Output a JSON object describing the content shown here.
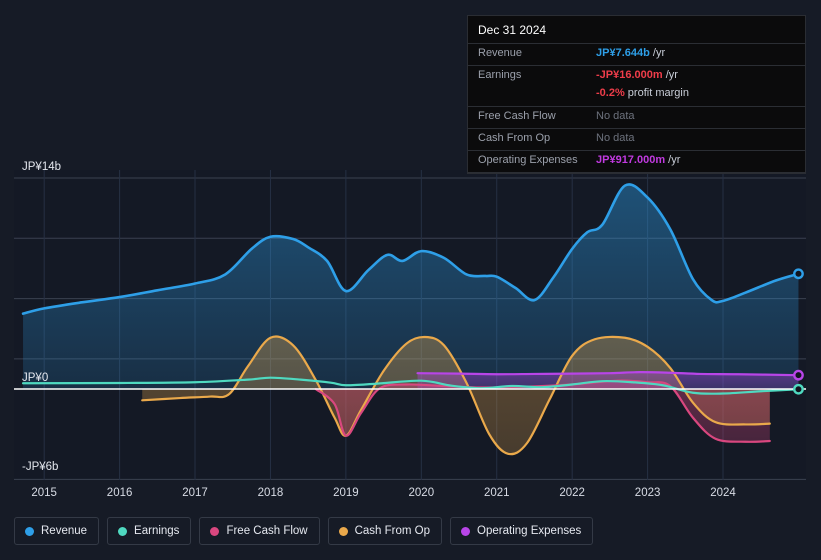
{
  "tooltip": {
    "title": "Dec 31 2024",
    "rows": [
      {
        "key": "Revenue",
        "value": "JP¥7.644b",
        "unit": "/yr",
        "color_class": "c-rev",
        "nodata": false
      },
      {
        "key": "Earnings",
        "value": "-JP¥16.000m",
        "unit": "/yr",
        "color_class": "c-earn",
        "nodata": false
      },
      {
        "key": "",
        "value": "-0.2%",
        "unit": "profit margin",
        "color_class": "c-earn",
        "nodata": false,
        "sub": true
      },
      {
        "key": "Free Cash Flow",
        "value": "No data",
        "unit": "",
        "color_class": "",
        "nodata": true
      },
      {
        "key": "Cash From Op",
        "value": "No data",
        "unit": "",
        "color_class": "",
        "nodata": true
      },
      {
        "key": "Operating Expenses",
        "value": "JP¥917.000m",
        "unit": "/yr",
        "color_class": "c-opex",
        "nodata": false
      }
    ]
  },
  "legend": {
    "items": [
      {
        "label": "Revenue",
        "color": "#2e9fe8"
      },
      {
        "label": "Earnings",
        "color": "#4fd9c0"
      },
      {
        "label": "Free Cash Flow",
        "color": "#d9477f"
      },
      {
        "label": "Cash From Op",
        "color": "#eaa94b"
      },
      {
        "label": "Operating Expenses",
        "color": "#b845e8"
      }
    ]
  },
  "axes": {
    "y_top_label": "JP¥14b",
    "y_zero_label": "JP¥0",
    "y_bottom_label": "-JP¥6b",
    "x_labels": [
      "2015",
      "2016",
      "2017",
      "2018",
      "2019",
      "2020",
      "2021",
      "2022",
      "2023",
      "2024"
    ]
  },
  "chart_data": {
    "type": "area",
    "title": "",
    "subtitle": "",
    "xlabel": "",
    "ylabel": "JP¥",
    "currency": "JPY",
    "y_unit": "billions",
    "ylim": [
      -6,
      14
    ],
    "y_ticks": [
      14,
      10,
      6,
      2,
      -6
    ],
    "y_tick_labels": [
      "JP¥14b",
      "",
      "",
      "",
      "-JP¥6b"
    ],
    "zero_line": 0,
    "grid": true,
    "legend_position": "bottom-left",
    "x": [
      "2015",
      "2016",
      "2017",
      "2018",
      "2019",
      "2020",
      "2021",
      "2022",
      "2023",
      "2024"
    ],
    "xlim": [
      "2014.6",
      "2025.1"
    ],
    "series": [
      {
        "name": "Revenue",
        "color": "#2e9fe8",
        "fill": true,
        "points": [
          {
            "x": 2014.72,
            "y": 5.0
          },
          {
            "x": 2015.0,
            "y": 5.35
          },
          {
            "x": 2015.5,
            "y": 5.75
          },
          {
            "x": 2016.0,
            "y": 6.1
          },
          {
            "x": 2016.5,
            "y": 6.55
          },
          {
            "x": 2017.0,
            "y": 7.0
          },
          {
            "x": 2017.4,
            "y": 7.6
          },
          {
            "x": 2017.75,
            "y": 9.3
          },
          {
            "x": 2018.0,
            "y": 10.1
          },
          {
            "x": 2018.3,
            "y": 9.95
          },
          {
            "x": 2018.5,
            "y": 9.4
          },
          {
            "x": 2018.75,
            "y": 8.5
          },
          {
            "x": 2019.0,
            "y": 6.5
          },
          {
            "x": 2019.3,
            "y": 7.9
          },
          {
            "x": 2019.55,
            "y": 8.9
          },
          {
            "x": 2019.75,
            "y": 8.5
          },
          {
            "x": 2020.0,
            "y": 9.15
          },
          {
            "x": 2020.3,
            "y": 8.7
          },
          {
            "x": 2020.6,
            "y": 7.6
          },
          {
            "x": 2020.85,
            "y": 7.5
          },
          {
            "x": 2021.0,
            "y": 7.45
          },
          {
            "x": 2021.25,
            "y": 6.7
          },
          {
            "x": 2021.5,
            "y": 5.9
          },
          {
            "x": 2021.75,
            "y": 7.4
          },
          {
            "x": 2022.0,
            "y": 9.3
          },
          {
            "x": 2022.2,
            "y": 10.4
          },
          {
            "x": 2022.4,
            "y": 10.9
          },
          {
            "x": 2022.7,
            "y": 13.5
          },
          {
            "x": 2023.0,
            "y": 12.7
          },
          {
            "x": 2023.3,
            "y": 10.6
          },
          {
            "x": 2023.6,
            "y": 7.3
          },
          {
            "x": 2023.85,
            "y": 5.9
          },
          {
            "x": 2024.0,
            "y": 5.85
          },
          {
            "x": 2024.3,
            "y": 6.4
          },
          {
            "x": 2024.7,
            "y": 7.2
          },
          {
            "x": 2025.0,
            "y": 7.644
          }
        ]
      },
      {
        "name": "Earnings",
        "color": "#4fd9c0",
        "fill": false,
        "points": [
          {
            "x": 2014.72,
            "y": 0.38
          },
          {
            "x": 2016.0,
            "y": 0.4
          },
          {
            "x": 2017.0,
            "y": 0.45
          },
          {
            "x": 2017.7,
            "y": 0.62
          },
          {
            "x": 2018.0,
            "y": 0.75
          },
          {
            "x": 2018.4,
            "y": 0.62
          },
          {
            "x": 2018.8,
            "y": 0.42
          },
          {
            "x": 2019.0,
            "y": 0.25
          },
          {
            "x": 2019.4,
            "y": 0.35
          },
          {
            "x": 2020.0,
            "y": 0.55
          },
          {
            "x": 2020.4,
            "y": 0.22
          },
          {
            "x": 2020.8,
            "y": 0.05
          },
          {
            "x": 2021.2,
            "y": 0.2
          },
          {
            "x": 2021.6,
            "y": 0.12
          },
          {
            "x": 2022.0,
            "y": 0.3
          },
          {
            "x": 2022.4,
            "y": 0.52
          },
          {
            "x": 2022.8,
            "y": 0.45
          },
          {
            "x": 2023.2,
            "y": 0.25
          },
          {
            "x": 2023.6,
            "y": -0.25
          },
          {
            "x": 2024.0,
            "y": -0.3
          },
          {
            "x": 2024.5,
            "y": -0.15
          },
          {
            "x": 2025.0,
            "y": -0.016
          }
        ]
      },
      {
        "name": "Free Cash Flow",
        "color": "#d9477f",
        "fill": true,
        "points": [
          {
            "x": 2018.6,
            "y": 0.0
          },
          {
            "x": 2018.85,
            "y": -1.0
          },
          {
            "x": 2019.0,
            "y": -3.1
          },
          {
            "x": 2019.2,
            "y": -1.6
          },
          {
            "x": 2019.45,
            "y": 0.05
          },
          {
            "x": 2019.8,
            "y": 0.3
          },
          {
            "x": 2020.3,
            "y": 0.2
          },
          {
            "x": 2020.8,
            "y": 0.1
          },
          {
            "x": 2021.4,
            "y": 0.15
          },
          {
            "x": 2022.0,
            "y": 0.3
          },
          {
            "x": 2022.6,
            "y": 0.55
          },
          {
            "x": 2023.0,
            "y": 0.45
          },
          {
            "x": 2023.3,
            "y": 0.2
          },
          {
            "x": 2023.6,
            "y": -1.9
          },
          {
            "x": 2023.9,
            "y": -3.3
          },
          {
            "x": 2024.3,
            "y": -3.5
          },
          {
            "x": 2024.62,
            "y": -3.45
          }
        ]
      },
      {
        "name": "Cash From Op",
        "color": "#eaa94b",
        "fill": true,
        "points": [
          {
            "x": 2016.3,
            "y": -0.75
          },
          {
            "x": 2016.8,
            "y": -0.6
          },
          {
            "x": 2017.2,
            "y": -0.5
          },
          {
            "x": 2017.45,
            "y": -0.35
          },
          {
            "x": 2017.7,
            "y": 1.5
          },
          {
            "x": 2018.0,
            "y": 3.4
          },
          {
            "x": 2018.3,
            "y": 2.9
          },
          {
            "x": 2018.6,
            "y": 0.6
          },
          {
            "x": 2018.85,
            "y": -1.9
          },
          {
            "x": 2019.0,
            "y": -3.1
          },
          {
            "x": 2019.2,
            "y": -1.4
          },
          {
            "x": 2019.5,
            "y": 1.2
          },
          {
            "x": 2019.8,
            "y": 3.0
          },
          {
            "x": 2020.05,
            "y": 3.45
          },
          {
            "x": 2020.3,
            "y": 2.9
          },
          {
            "x": 2020.6,
            "y": 0.4
          },
          {
            "x": 2020.9,
            "y": -3.0
          },
          {
            "x": 2021.15,
            "y": -4.3
          },
          {
            "x": 2021.4,
            "y": -3.6
          },
          {
            "x": 2021.7,
            "y": -0.7
          },
          {
            "x": 2022.0,
            "y": 2.2
          },
          {
            "x": 2022.3,
            "y": 3.3
          },
          {
            "x": 2022.7,
            "y": 3.4
          },
          {
            "x": 2023.0,
            "y": 2.8
          },
          {
            "x": 2023.3,
            "y": 1.4
          },
          {
            "x": 2023.6,
            "y": -0.9
          },
          {
            "x": 2023.9,
            "y": -2.2
          },
          {
            "x": 2024.3,
            "y": -2.35
          },
          {
            "x": 2024.62,
            "y": -2.3
          }
        ]
      },
      {
        "name": "Operating Expenses",
        "color": "#b845e8",
        "fill": true,
        "points": [
          {
            "x": 2019.95,
            "y": 1.05
          },
          {
            "x": 2020.5,
            "y": 1.02
          },
          {
            "x": 2021.0,
            "y": 0.98
          },
          {
            "x": 2021.5,
            "y": 1.0
          },
          {
            "x": 2022.0,
            "y": 1.02
          },
          {
            "x": 2022.5,
            "y": 1.05
          },
          {
            "x": 2022.9,
            "y": 1.12
          },
          {
            "x": 2023.3,
            "y": 1.08
          },
          {
            "x": 2023.7,
            "y": 1.0
          },
          {
            "x": 2024.2,
            "y": 0.98
          },
          {
            "x": 2025.0,
            "y": 0.917
          }
        ]
      }
    ],
    "endpoints": [
      {
        "series": "Revenue",
        "x": 2025.0,
        "y": 7.644,
        "color": "#2e9fe8"
      },
      {
        "series": "Operating Expenses",
        "x": 2025.0,
        "y": 0.917,
        "color": "#b845e8"
      },
      {
        "series": "Earnings",
        "x": 2025.0,
        "y": -0.016,
        "color": "#4fd9c0"
      }
    ]
  }
}
